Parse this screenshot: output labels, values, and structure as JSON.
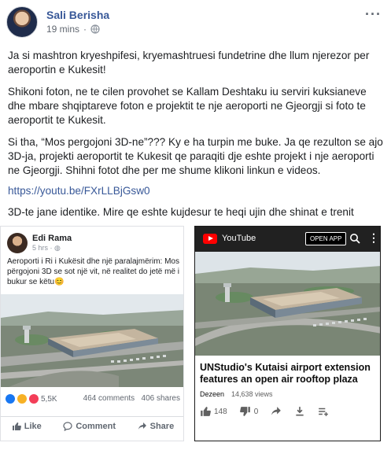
{
  "post": {
    "author": "Sali Berisha",
    "time": "19 mins",
    "separator": "·",
    "paragraphs": [
      "Ja si mashtron kryeshpifesi, kryemashtruesi fundetrine dhe llum njerezor per aeroportin e Kukesit!",
      "Shikoni foton, ne te cilen provohet se Kallam Deshtaku iu serviri kuksianeve dhe mbare shqiptareve foton e projektit te nje aeroporti ne Gjeorgji si foto te aeroportit te Kukesit.",
      "Si tha, “Mos pergojoni 3D-ne”??? Ky e ha turpin me buke. Ja qe rezulton se ajo 3D-ja, projekti aeroportit te Kukesit qe paraqiti dje eshte projekt i nje aeroporti ne Gjeorgji. Shihni fotot dhe per me shume klikoni linkun e videos.",
      "https://youtu.be/FXrLLBjGsw0",
      "3D-te jane identike. Mire qe eshte kujdesur te heqi ujin dhe shinat e trenit"
    ]
  },
  "left_shot": {
    "author": "Edi Rama",
    "time": "5 hrs · ",
    "caption": "Aeroporti i Ri i Kukësit dhe një paralajmërim: Mos përgojoni 3D se sot një vit, në realitet do jetë më i bukur se këtu😊",
    "reactions_count": "5,5K",
    "comments": "464 comments",
    "shares": "406 shares",
    "like_label": "Like",
    "comment_label": "Comment",
    "share_label": "Share"
  },
  "right_shot": {
    "app_name": "YouTube",
    "open_app_label": "OPEN APP",
    "video_title": "UNStudio's Kutaisi airport extension features an open air rooftop plaza",
    "channel": "Dezeen",
    "views": "14,638 views",
    "likes": "148",
    "dislikes": "0"
  },
  "colors": {
    "link": "#385898",
    "youtube_red": "#ff0000"
  }
}
